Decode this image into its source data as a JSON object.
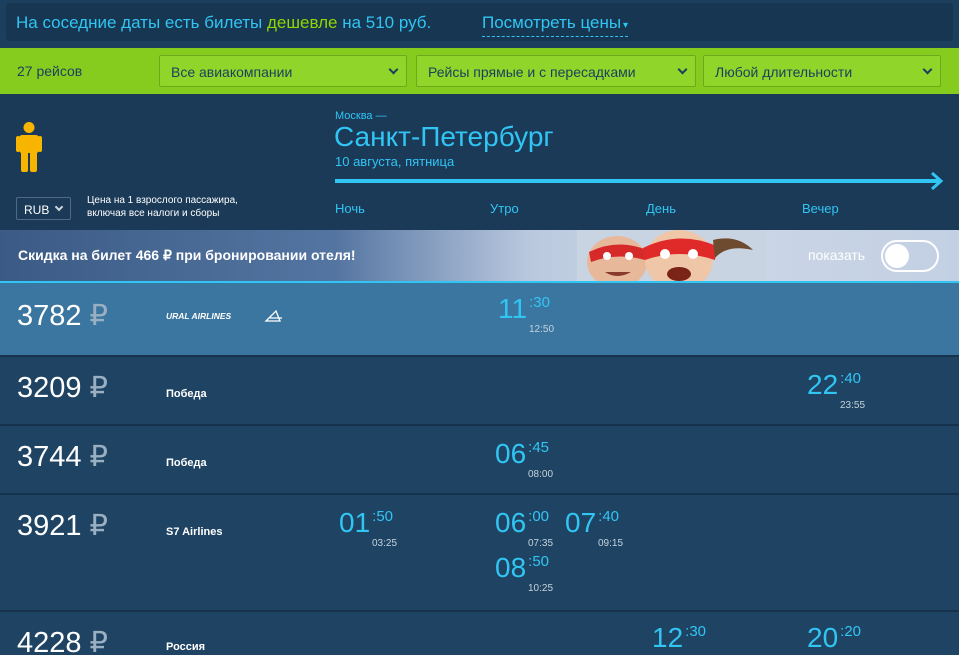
{
  "banner": {
    "text_before": "На соседние даты есть билеты ",
    "text_cheap": "дешевле",
    "text_after": " на 510 руб.",
    "link_label": "Посмотреть цены",
    "link_caret": "▾"
  },
  "filters": {
    "count": "27 рейсов",
    "airlines": "Все авиакомпании",
    "stops": "Рейсы прямые и с пересадками",
    "duration": "Любой длительности"
  },
  "header": {
    "passenger_icon": "person-icon",
    "currency": "RUB",
    "price_note_line1": "Цена на 1 взрослого пассажира,",
    "price_note_line2": "включая все налоги и сборы",
    "from": "Москва —",
    "to": "Санкт-Петербург",
    "date": "10 августа, пятница",
    "periods": [
      "Ночь",
      "Утро",
      "День",
      "Вечер"
    ]
  },
  "promo": {
    "text": "Скидка на билет 466 ₽ при бронировании отеля!",
    "show_label": "показать",
    "toggle_on": false
  },
  "currency_symbol": "₽",
  "flights": [
    {
      "price": "3782",
      "airline": "URAL AIRLINES",
      "selected": true,
      "times": [
        {
          "hh": "11",
          "mm": ":30",
          "arr": "12:50"
        }
      ]
    },
    {
      "price": "3209",
      "airline": "Победа",
      "selected": false,
      "times": [
        {
          "hh": "22",
          "mm": ":40",
          "arr": "23:55"
        }
      ]
    },
    {
      "price": "3744",
      "airline": "Победа",
      "selected": false,
      "times": [
        {
          "hh": "06",
          "mm": ":45",
          "arr": "08:00"
        }
      ]
    },
    {
      "price": "3921",
      "airline": "S7 Airlines",
      "selected": false,
      "times": [
        {
          "hh": "01",
          "mm": ":50",
          "arr": "03:25"
        },
        {
          "hh": "06",
          "mm": ":00",
          "arr": "07:35"
        },
        {
          "hh": "07",
          "mm": ":40",
          "arr": "09:15"
        },
        {
          "hh": "08",
          "mm": ":50",
          "arr": "10:25"
        }
      ]
    },
    {
      "price": "4228",
      "airline": "Россия",
      "selected": false,
      "times": [
        {
          "hh": "12",
          "mm": ":30",
          "arr": ""
        },
        {
          "hh": "20",
          "mm": ":20",
          "arr": ""
        }
      ]
    }
  ]
}
